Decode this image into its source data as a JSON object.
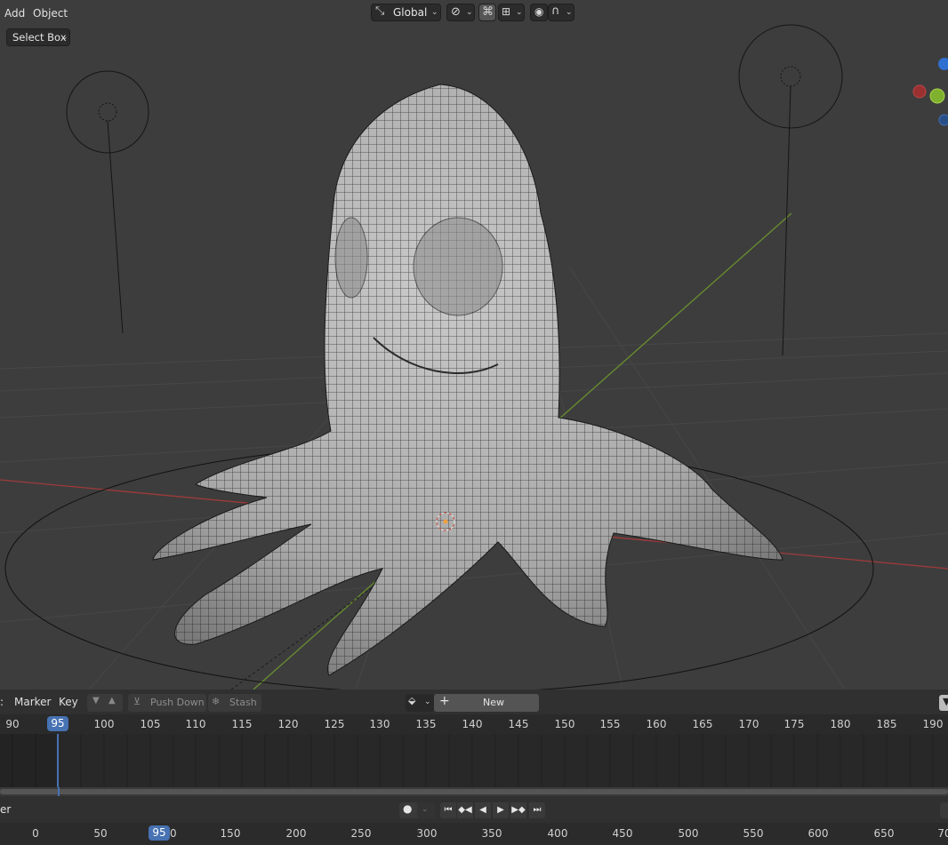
{
  "header": {
    "menus": [
      "Add",
      "Object"
    ],
    "select_mode": "Select Box",
    "transform_orientation": "Global"
  },
  "dopesheet": {
    "menus": [
      "Marker",
      "Key"
    ],
    "push_down": "Push Down",
    "stash": "Stash",
    "new_action": "New",
    "ruler_ticks": [
      "90",
      "100",
      "105",
      "110",
      "115",
      "120",
      "125",
      "130",
      "135",
      "140",
      "145",
      "150",
      "155",
      "160",
      "165",
      "170",
      "175",
      "180",
      "185",
      "190"
    ],
    "current_frame": "95"
  },
  "timeline": {
    "label_fragment": "er",
    "ruler_ticks": [
      "0",
      "50",
      "150",
      "200",
      "250",
      "300",
      "350",
      "400",
      "450",
      "500",
      "550",
      "600",
      "650",
      "70"
    ],
    "current_frame": "95",
    "current_frame_suffix": "0"
  },
  "colors": {
    "viewport_bg": "#3d3d3d",
    "frame_indicator": "#4772b3",
    "x_axis": "#a03a3a",
    "y_axis": "#6a8f2f"
  }
}
